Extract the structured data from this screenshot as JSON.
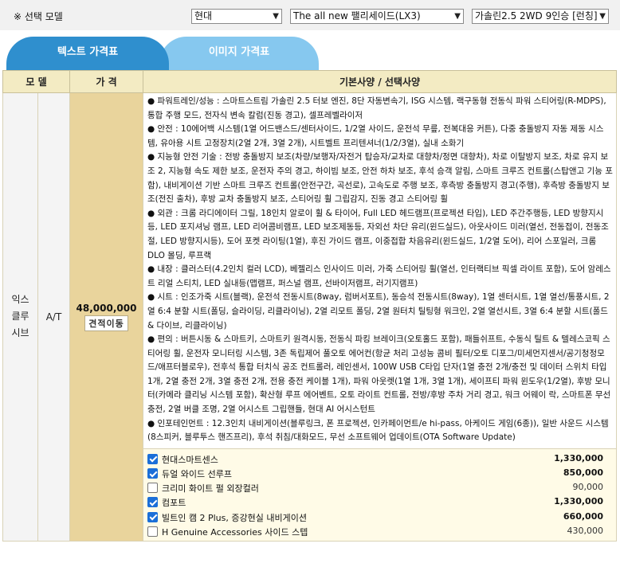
{
  "selector": {
    "label": "※ 선택 모델",
    "brand": "현대",
    "model": "The all new 팰리세이드(LX3)",
    "trim": "가솔린2.5 2WD 9인승 [런칭]"
  },
  "tabs": [
    {
      "label": "텍스트 가격표",
      "active": true
    },
    {
      "label": "이미지 가격표",
      "active": false
    }
  ],
  "table": {
    "headers": {
      "model": "모 델",
      "price": "가 격",
      "spec": "기본사양 / 선택사양"
    },
    "row": {
      "model": "익스 클루 시브",
      "transmission": "A/T",
      "price": "48,000,000",
      "quote_button": "견적이동",
      "spec_lines": [
        "● 파워트레인/성능 : 스마트스트림 가솔린 2.5 터보 엔진, 8단 자동변속기, ISG 시스템, 랙구동형 전동식 파워 스티어링(R-MDPS), 통합 주행 모드, 전자식 변속 칼럼(진동 경고), 셀프레벨라이저",
        "● 안전 : 10에어백 시스템(1열 어드밴스드/센터사이드, 1/2열 사이드, 운전석 무릎, 전복대응 커튼), 다중 충돌방지 자동 제동 시스템, 유아용 시트 고정장치(2열 2개, 3열 2개), 시트벨트 프리텐셔너(1/2/3열), 실내 소화기",
        "● 지능형 안전 기술 : 전방 충돌방지 보조(차량/보행자/자전거 탑승자/교차로 대향차/정면 대향차), 차로 이탈방지 보조, 차로 유지 보조 2, 지능형 속도 제한 보조, 운전자 주의 경고, 하이빔 보조, 안전 하차 보조, 후석 승객 알림, 스마트 크루즈 컨트롤(스탑앤고 기능 포함), 내비게이션 기반 스마트 크루즈 컨트롤(안전구간, 곡선로), 고속도로 주행 보조, 후측방 충돌방지 경고(주행), 후측방 충돌방지 보조(전진 출차), 후방 교차 충돌방지 보조, 스티어링 휠 그립감지, 진동 경고 스티어링 휠",
        "● 외관 : 크롬 라디에이터 그릴, 18인치 알로이 휠 & 타이어, Full LED 헤드램프(프로젝션 타입), LED 주간주행등, LED 방향지시등, LED 포지셔닝 램프, LED 리어콤비램프, LED 보조제동등, 자외선 차단 유리(윈드실드), 아웃사이드 미러(열선, 전동접이, 전동조절, LED 방향지시등), 도어 포켓 라이팅(1열), 후진 가이드 램프, 이중접합 차음유리(윈드실드, 1/2열 도어), 리어 스포일러, 크롬 DLO 몰딩, 루프랙",
        "● 내장 : 클러스터(4.2인치 컬러 LCD), 베젤리스 인사이드 미러, 가죽 스티어링 휠(열선, 인터랙티브 픽셀 라이트 포함), 도어 암레스트 리얼 스티치, LED 실내등(맵램프, 퍼스널 램프, 선바이저램프, 러기지램프)",
        "● 시트 : 인조가죽 시트(블랙), 운전석 전동시트(8way, 럼버서포트), 동승석 전동시트(8way), 1열 센터시트, 1열 열선/통풍시트, 2열 6:4 분할 시트(폴딩, 슬라이딩, 리클라이닝), 2열 리모트 폴딩, 2열 원터치 틸팅형 워크인, 2열 열선시트, 3열 6:4 분할 시트(폴드 & 다이브, 리클라이닝)",
        "● 편의 : 버튼시동 & 스마트키, 스마트키 원격시동, 전동식 파킹 브레이크(오토홀드 포함), 패들쉬프트, 수동식 틸트 & 텔레스코픽 스티어링 휠, 운전자 모니터링 시스템, 3존 독립제어 풀오토 에어컨(항균 처리 고성능 콤비 필터/오토 디포그/미세먼지센서/공기청정모드/애프터블로우), 전후석 통합 터치식 공조 컨트롤러, 레인센서, 100W USB C타입 단자(1열 충전 2개/충전 및 데이터 스위치 타입 1개, 2열 충전 2개, 3열 충전 2개, 전용 충전 케이블 1개), 파워 아웃렛(1열 1개, 3열 1개), 세이프티 파워 윈도우(1/2열), 후방 모니터(카메라 클리닝 시스템 포함), 확산형 루프 에어벤트, 오토 라이트 컨트롤, 전방/후방 주차 거리 경고, 워크 어웨이 락, 스마트폰 무선충전, 2열 버클 조명, 2열 어시스트 그립핸들, 현대 AI 어시스턴트",
        "● 인포테인먼트 : 12.3인치 내비게이션(블루링크, 폰 프로젝션, 인카페이먼트/e hi-pass, 아케이드 게임(6종)), 일반 사운드 시스템(8스피커, 블루투스 핸즈프리), 후석 취침/대화모드, 무선 소프트웨어 업데이트(OTA Software Update)"
      ],
      "options": [
        {
          "name": "현대스마트센스",
          "price": "1,330,000",
          "checked": true
        },
        {
          "name": "듀얼 와이드 선루프",
          "price": "850,000",
          "checked": true
        },
        {
          "name": "크리미 화이트 펄 외장컬러",
          "price": "90,000",
          "checked": false
        },
        {
          "name": "컴포트",
          "price": "1,330,000",
          "checked": true
        },
        {
          "name": "빌트인 캠 2 Plus, 증강현실 내비게이션",
          "price": "660,000",
          "checked": true
        },
        {
          "name": "H Genuine Accessories 사이드 스텝",
          "price": "430,000",
          "checked": false
        }
      ]
    }
  }
}
